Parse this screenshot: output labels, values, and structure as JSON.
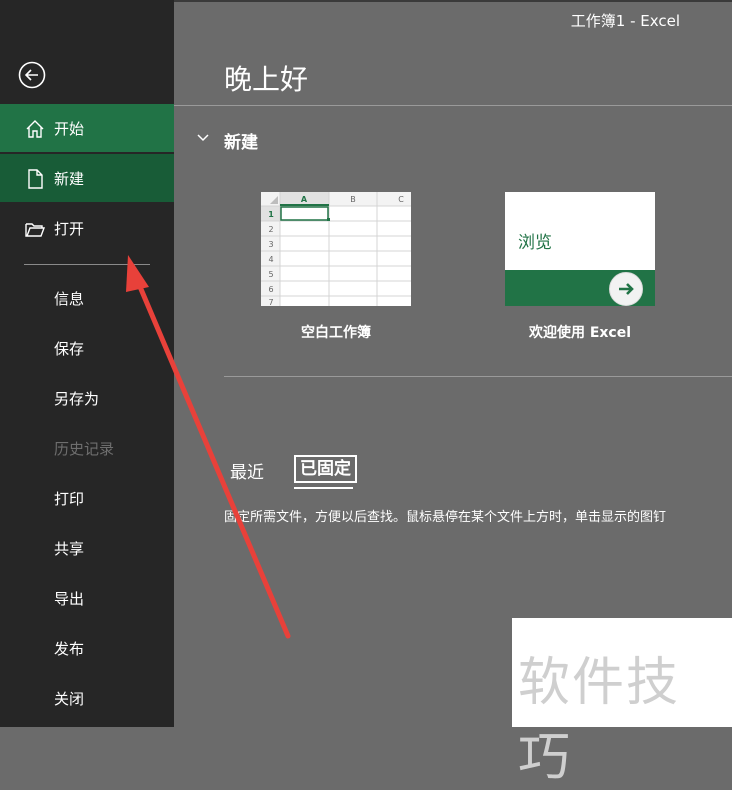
{
  "window": {
    "title": "工作簿1  -  Excel"
  },
  "sidebar": {
    "items": [
      {
        "label": "开始",
        "icon": "home-icon"
      },
      {
        "label": "新建",
        "icon": "new-document-icon"
      },
      {
        "label": "打开",
        "icon": "open-folder-icon"
      },
      {
        "label": "信息"
      },
      {
        "label": "保存"
      },
      {
        "label": "另存为"
      },
      {
        "label": "历史记录",
        "disabled": true
      },
      {
        "label": "打印"
      },
      {
        "label": "共享"
      },
      {
        "label": "导出"
      },
      {
        "label": "发布"
      },
      {
        "label": "关闭"
      }
    ]
  },
  "main": {
    "greeting": "晚上好",
    "new_section": {
      "title": "新建"
    },
    "templates": [
      {
        "caption": "空白工作簿",
        "sheet": {
          "columns": [
            "A",
            "B",
            "C"
          ],
          "rows": [
            "1",
            "2",
            "3",
            "4",
            "5",
            "6",
            "7"
          ]
        }
      },
      {
        "caption": "欢迎使用 Excel",
        "label": "浏览"
      }
    ],
    "tabs": {
      "recent": "最近",
      "pinned": "已固定"
    },
    "pinned_description": "固定所需文件，方便以后查找。鼠标悬停在某个文件上方时，单击显示的图钉"
  },
  "watermark": "软件技巧",
  "colors": {
    "sidebar": "#262626",
    "accent": "#217346",
    "active": "#185c37",
    "background": "#6b6b6b",
    "annotation_arrow": "#e8413a"
  }
}
